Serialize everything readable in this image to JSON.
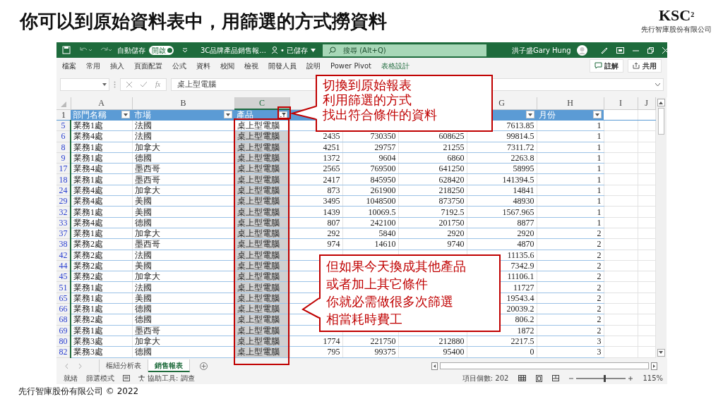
{
  "slide": {
    "title": "你可以到原始資料表中，用篩選的方式撈資料",
    "footer": "先行智庫股份有限公司 © 2022"
  },
  "logo": {
    "text": "KSC",
    "sup": "2",
    "caption": "先行智庫股份有限公司"
  },
  "titlebar": {
    "autosave_label": "自動儲存",
    "autosave_toggle": "開啟",
    "autosave_on": true,
    "filename": "3C品牌產品銷售報...",
    "saved": "• 已儲存",
    "search_placeholder": "搜尋 (Alt+Q)",
    "user": "洪子盛Gary Hung"
  },
  "ribbon_tabs": [
    {
      "label": "檔案",
      "kind": "tab"
    },
    {
      "label": "常用",
      "kind": "tab"
    },
    {
      "label": "插入",
      "kind": "tab"
    },
    {
      "label": "頁面配置",
      "kind": "tab"
    },
    {
      "label": "公式",
      "kind": "tab"
    },
    {
      "label": "資料",
      "kind": "tab"
    },
    {
      "label": "校閱",
      "kind": "tab"
    },
    {
      "label": "檢視",
      "kind": "tab"
    },
    {
      "label": "開發人員",
      "kind": "tab"
    },
    {
      "label": "說明",
      "kind": "tab"
    },
    {
      "label": "Power Pivot",
      "kind": "tab"
    },
    {
      "label": "表格設計",
      "kind": "contextual"
    }
  ],
  "ribbon_buttons": [
    {
      "label": "註解",
      "kind": "comment"
    },
    {
      "label": "共用",
      "kind": "share"
    }
  ],
  "formula_bar": {
    "fx": "fx",
    "value": "桌上型電腦"
  },
  "header_row_number": "1",
  "columns": [
    {
      "kind": "column",
      "letter": "A",
      "selected": false,
      "heading": "部門名稱",
      "filtered": false
    },
    {
      "kind": "column",
      "letter": "B",
      "selected": false,
      "heading": "市場",
      "filtered": false
    },
    {
      "kind": "column",
      "letter": "C",
      "selected": true,
      "heading": "產品",
      "filtered": true
    },
    {
      "kind": "covered"
    },
    {
      "kind": "covered"
    },
    {
      "kind": "covered"
    },
    {
      "kind": "column",
      "letter": "G",
      "selected": false,
      "filtered": false
    },
    {
      "kind": "column",
      "letter": "H",
      "selected": false,
      "heading": "月份",
      "filtered": false
    },
    {
      "kind": "column",
      "letter": "I",
      "selected": false
    },
    {
      "kind": "column",
      "letter": "J",
      "selected": false
    }
  ],
  "rows": [
    {
      "number": "5",
      "product_selected": false,
      "cells": [
        "業務1處",
        "法國",
        "桌上型電腦",
        null,
        null,
        null,
        "7613.85",
        "1"
      ]
    },
    {
      "number": "6",
      "product_selected": true,
      "cells": [
        "業務4處",
        "法國",
        "桌上型電腦",
        "2435",
        "730350",
        "608625",
        "99814.5",
        "1"
      ]
    },
    {
      "number": "8",
      "product_selected": true,
      "cells": [
        "業務1處",
        "加拿大",
        "桌上型電腦",
        "4251",
        "29757",
        "21255",
        "7311.72",
        "1"
      ]
    },
    {
      "number": "9",
      "product_selected": true,
      "cells": [
        "業務1處",
        "德國",
        "桌上型電腦",
        "1372",
        "9604",
        "6860",
        "2263.8",
        "1"
      ]
    },
    {
      "number": "17",
      "product_selected": true,
      "cells": [
        "業務4處",
        "墨西哥",
        "桌上型電腦",
        "2565",
        "769500",
        "641250",
        "58995",
        "1"
      ]
    },
    {
      "number": "18",
      "product_selected": true,
      "cells": [
        "業務1處",
        "墨西哥",
        "桌上型電腦",
        "2417",
        "845950",
        "628420",
        "141394.5",
        "1"
      ]
    },
    {
      "number": "24",
      "product_selected": true,
      "cells": [
        "業務4處",
        "加拿大",
        "桌上型電腦",
        "873",
        "261900",
        "218250",
        "14841",
        "1"
      ]
    },
    {
      "number": "29",
      "product_selected": true,
      "cells": [
        "業務4處",
        "美國",
        "桌上型電腦",
        "3495",
        "1048500",
        "873750",
        "48930",
        "1"
      ]
    },
    {
      "number": "32",
      "product_selected": true,
      "cells": [
        "業務1處",
        "美國",
        "桌上型電腦",
        "1439",
        "10069.5",
        "7192.5",
        "1567.965",
        "1"
      ]
    },
    {
      "number": "33",
      "product_selected": true,
      "cells": [
        "業務4處",
        "德國",
        "桌上型電腦",
        "807",
        "242100",
        "201750",
        "8877",
        "1"
      ]
    },
    {
      "number": "37",
      "product_selected": true,
      "cells": [
        "業務1處",
        "加拿大",
        "桌上型電腦",
        "292",
        "5840",
        "2920",
        "2920",
        "2"
      ]
    },
    {
      "number": "38",
      "product_selected": true,
      "cells": [
        "業務2處",
        "墨西哥",
        "桌上型電腦",
        "974",
        "14610",
        "9740",
        "4870",
        "2"
      ]
    },
    {
      "number": "42",
      "product_selected": true,
      "cells": [
        "業務2處",
        "法國",
        "桌上型電腦",
        null,
        null,
        null,
        "11135.6",
        "2"
      ]
    },
    {
      "number": "44",
      "product_selected": true,
      "cells": [
        "業務2處",
        "美國",
        "桌上型電腦",
        null,
        null,
        null,
        "7342.9",
        "2"
      ]
    },
    {
      "number": "45",
      "product_selected": true,
      "cells": [
        "業務2處",
        "加拿大",
        "桌上型電腦",
        null,
        null,
        null,
        "11106.1",
        "2"
      ]
    },
    {
      "number": "51",
      "product_selected": true,
      "cells": [
        "業務1處",
        "法國",
        "桌上型電腦",
        null,
        null,
        null,
        "11727",
        "2"
      ]
    },
    {
      "number": "65",
      "product_selected": true,
      "cells": [
        "業務1處",
        "美國",
        "桌上型電腦",
        null,
        null,
        null,
        "19543.4",
        "2"
      ]
    },
    {
      "number": "66",
      "product_selected": true,
      "cells": [
        "業務1處",
        "德國",
        "桌上型電腦",
        null,
        null,
        null,
        "20039.2",
        "2"
      ]
    },
    {
      "number": "68",
      "product_selected": true,
      "cells": [
        "業務2處",
        "德國",
        "桌上型電腦",
        null,
        null,
        null,
        "806.2",
        "2"
      ]
    },
    {
      "number": "69",
      "product_selected": true,
      "cells": [
        "業務1處",
        "墨西哥",
        "桌上型電腦",
        null,
        null,
        null,
        "1872",
        "2"
      ]
    },
    {
      "number": "80",
      "product_selected": true,
      "cells": [
        "業務3處",
        "加拿大",
        "桌上型電腦",
        "1774",
        "221750",
        "212880",
        "2217.5",
        "3"
      ]
    },
    {
      "number": "82",
      "product_selected": true,
      "cells": [
        "業務3處",
        "德國",
        "桌上型電腦",
        "795",
        "99375",
        "95400",
        "0",
        "3"
      ]
    }
  ],
  "sheet_tabs": [
    {
      "label": "樞紐分析表",
      "selected": false
    },
    {
      "label": "銷售報表",
      "selected": true
    }
  ],
  "status_bar": {
    "ready": "就緒",
    "mode": "篩選模式",
    "accessibility": "協助工具: 調查",
    "count": "項目個數: 202",
    "zoom": "115%",
    "level": 0.55
  },
  "callouts": [
    {
      "lines": [
        "切換到原始報表",
        "利用篩選的方式",
        "找出符合條件的資料"
      ]
    },
    {
      "lines": [
        "但如果今天換成其他產品",
        "或者加上其它條件",
        "你就必需做很多次篩選",
        "相當耗時費工"
      ]
    }
  ]
}
